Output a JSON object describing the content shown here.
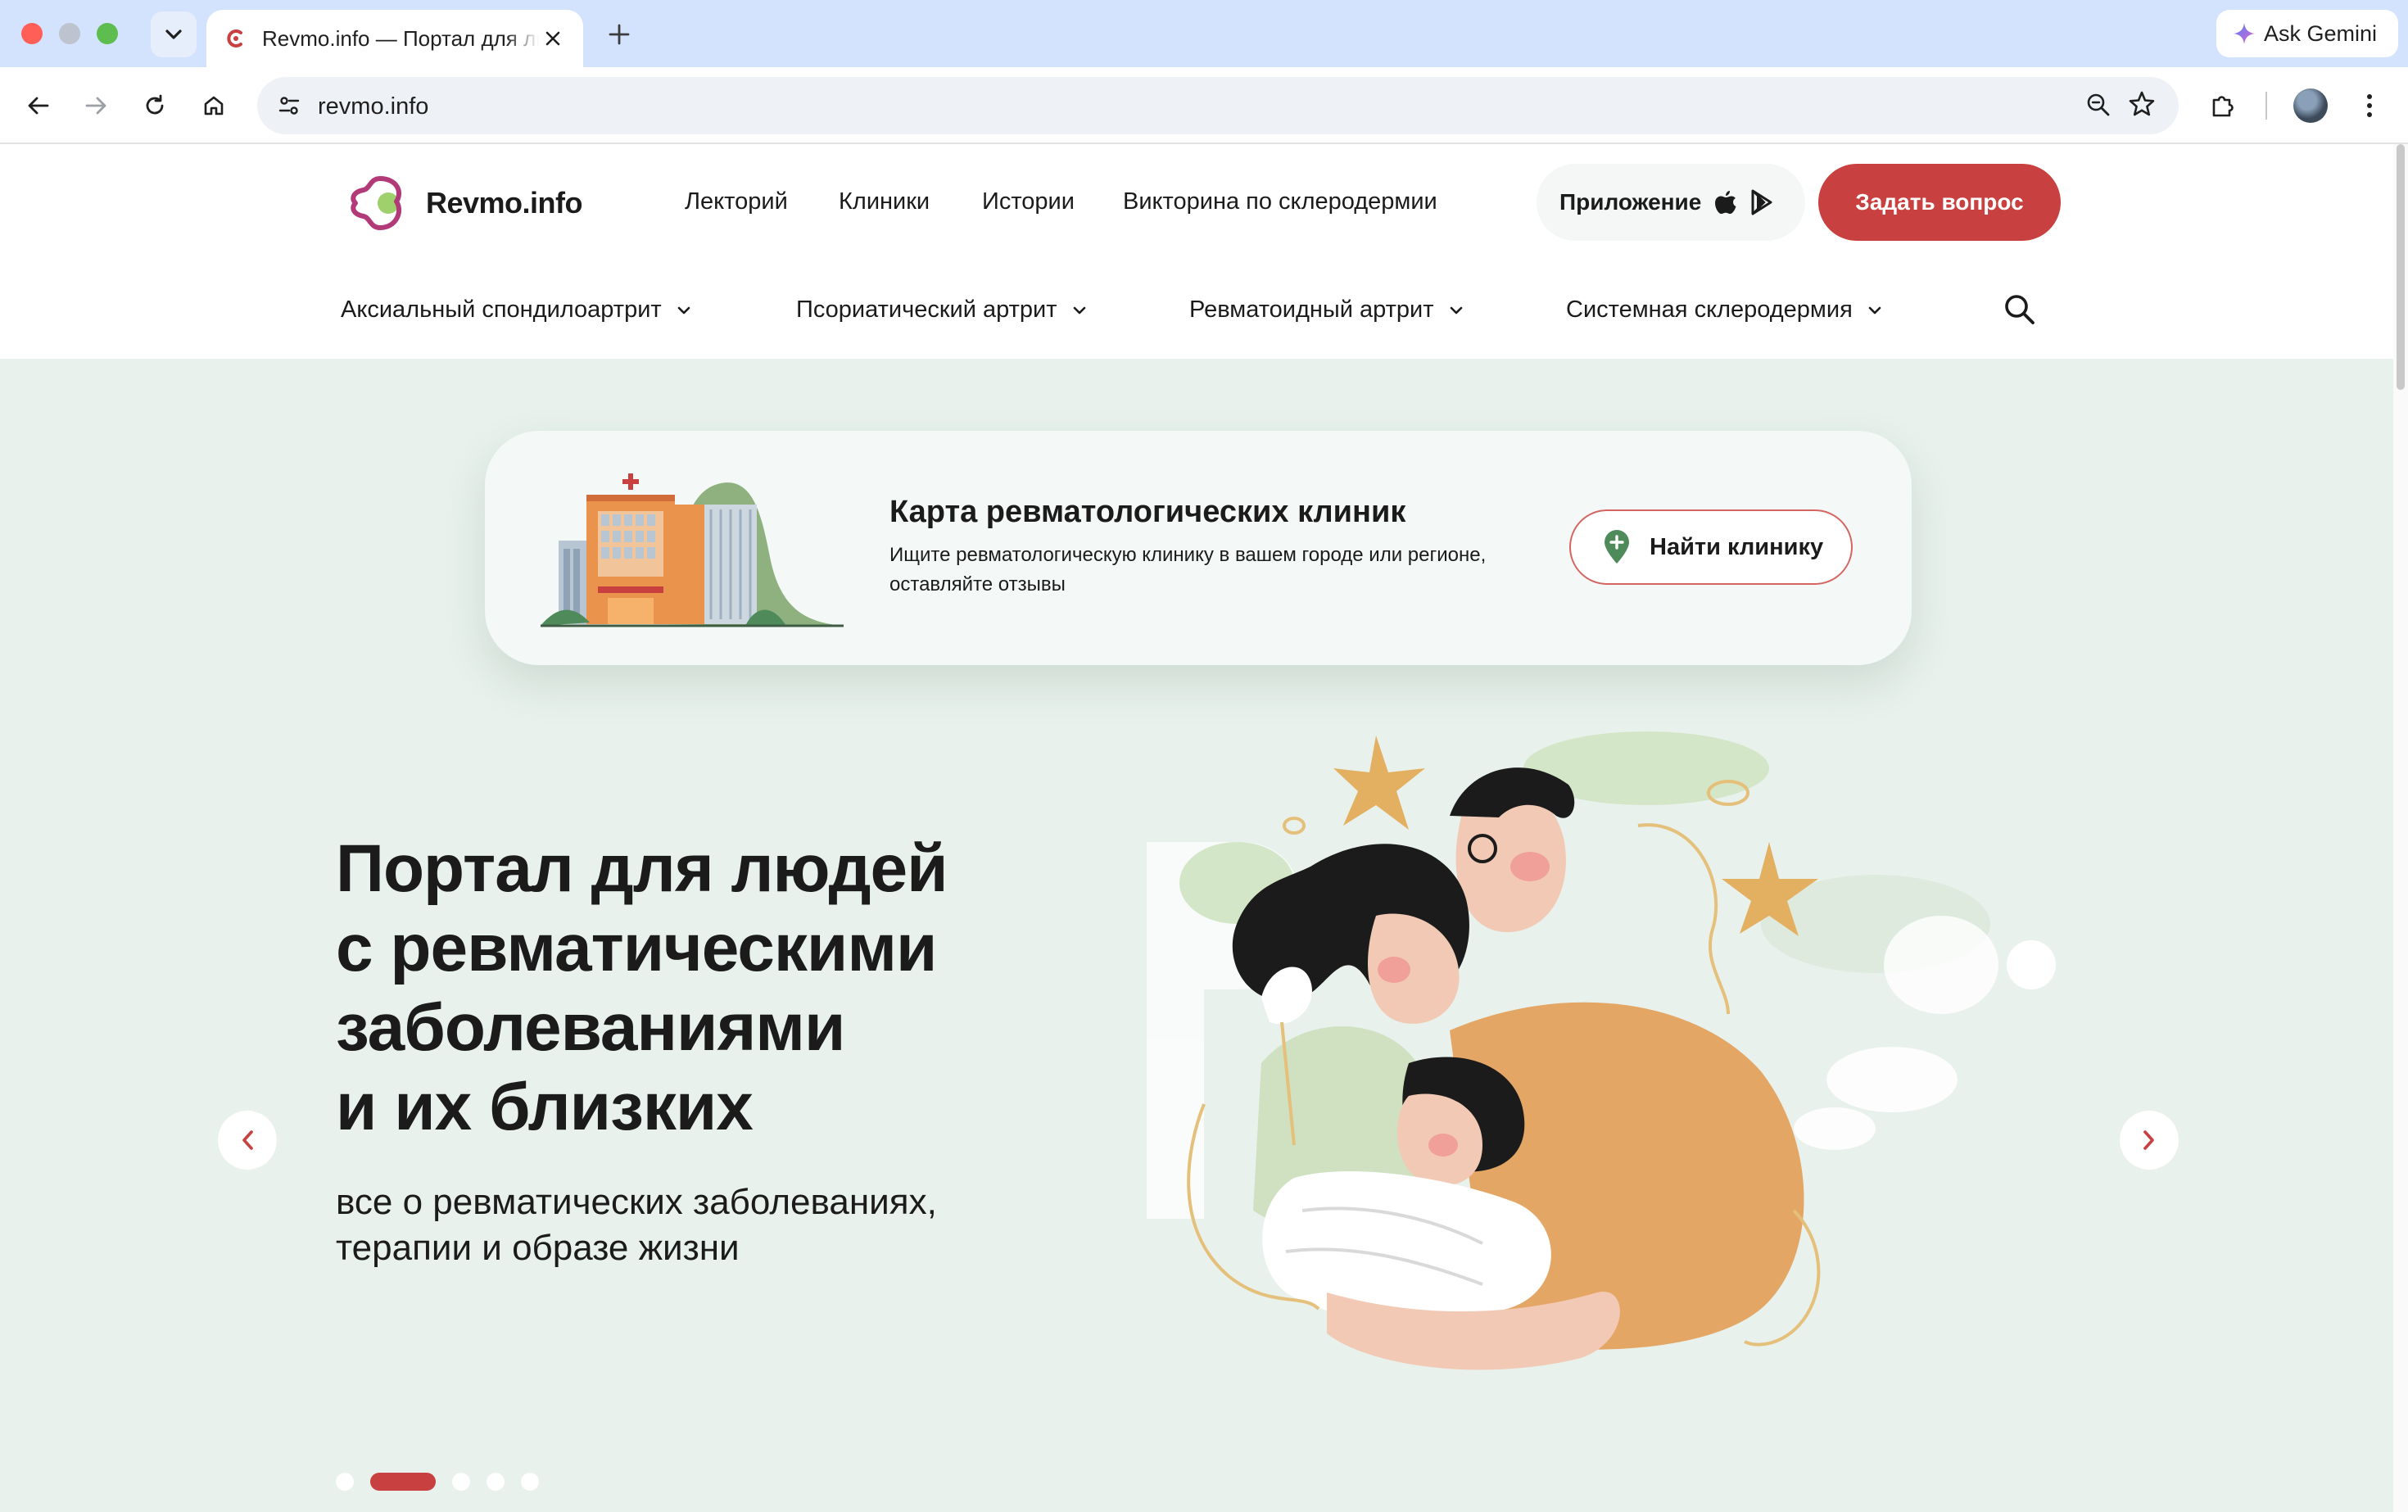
{
  "browser": {
    "tab_title": "Revmo.info — Портал для людей с ревматическими заболеваниями",
    "url": "revmo.info",
    "gemini_label": "Ask Gemini"
  },
  "header": {
    "logo_text": "Revmo.info",
    "nav": [
      "Лекторий",
      "Клиники",
      "Истории",
      "Викторина по склеродермии"
    ],
    "app_label": "Приложение",
    "ask_label": "Задать вопрос",
    "subnav": [
      "Аксиальный спондилоартрит",
      "Псориатический артрит",
      "Ревматоидный артрит",
      "Системная склеродермия"
    ]
  },
  "clinic_card": {
    "title": "Карта ревматологических клиник",
    "description": "Ищите ревматологическую клинику в вашем городе или регионе, оставляйте отзывы",
    "button": "Найти клинику"
  },
  "hero": {
    "title_lines": [
      "Портал для людей",
      "с ревматическими",
      "заболеваниями",
      "и их близких"
    ],
    "subtitle_lines": [
      "все о ревматических заболеваниях,",
      "терапии и образе жизни"
    ],
    "slide_count": 5,
    "active_slide": 2
  },
  "colors": {
    "accent": "#c8403f",
    "hero_bg": "#e8f1ec",
    "tab_bar": "#d3e3fd"
  }
}
